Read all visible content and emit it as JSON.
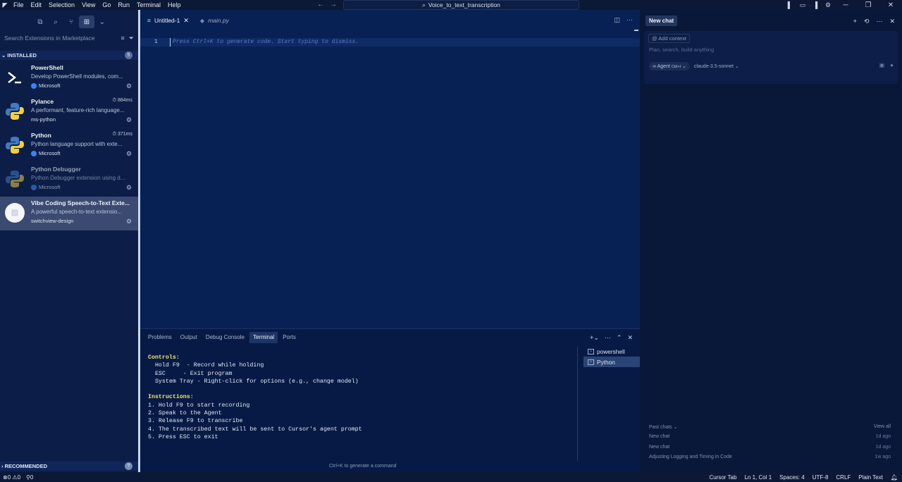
{
  "titlebar": {
    "menu": [
      "File",
      "Edit",
      "Selection",
      "View",
      "Go",
      "Run",
      "Terminal",
      "Help"
    ],
    "search_text": "Voice_to_text_transcription"
  },
  "sidebar": {
    "search_placeholder": "Search Extensions in Marketplace",
    "installed_label": "INSTALLED",
    "installed_count": "5",
    "recommended_label": "RECOMMENDED",
    "extensions": [
      {
        "name": "PowerShell",
        "description": "Develop PowerShell modules, com...",
        "publisher": "Microsoft",
        "time": ""
      },
      {
        "name": "Pylance",
        "description": "A performant, feature-rich language...",
        "publisher": "ms-python",
        "time": "884ms"
      },
      {
        "name": "Python",
        "description": "Python language support with exte...",
        "publisher": "Microsoft",
        "time": "371ms"
      },
      {
        "name": "Python Debugger",
        "description": "Python Debugger extension using d...",
        "publisher": "Microsoft",
        "time": ""
      },
      {
        "name": "Vibe Coding Speech-to-Text Exte...",
        "description": "A powerful speech-to-text extensio...",
        "publisher": "switchview-design",
        "time": ""
      }
    ]
  },
  "editor": {
    "tabs": [
      {
        "label": "Untitled-1",
        "active": true
      },
      {
        "label": "main.py",
        "active": false
      }
    ],
    "line_number": "1",
    "ghost_text": "Press Ctrl+K to generate code. Start typing to dismiss."
  },
  "panel": {
    "tabs": [
      "Problems",
      "Output",
      "Debug Console",
      "Terminal",
      "Ports"
    ],
    "active_tab": "Terminal",
    "terminal_lines": [
      {
        "text": "Controls:",
        "bold": true
      },
      {
        "text": "  Hold F9  - Record while holding",
        "bold": false
      },
      {
        "text": "  ESC     - Exit program",
        "bold": false
      },
      {
        "text": "  System Tray - Right-click for options (e.g., change model)",
        "bold": false
      },
      {
        "text": "",
        "bold": false
      },
      {
        "text": "Instructions:",
        "bold": true
      },
      {
        "text": "1. Hold F9 to start recording",
        "bold": false
      },
      {
        "text": "2. Speak to the Agent",
        "bold": false
      },
      {
        "text": "3. Release F9 to transcribe",
        "bold": false
      },
      {
        "text": "4. The transcribed text will be sent to Cursor's agent prompt",
        "bold": false
      },
      {
        "text": "5. Press ESC to exit",
        "bold": false
      }
    ],
    "terminals": [
      "powershell",
      "Python"
    ],
    "hint": "Ctrl+K to generate a command"
  },
  "chat": {
    "tab_label": "New chat",
    "add_context": "Add context",
    "placeholder": "Plan, search, build anything",
    "agent_label": "Agent",
    "agent_shortcut": "Ctrl+I",
    "model": "claude-3.5-sonnet",
    "past_label": "Past chats",
    "view_all": "View all",
    "past_chats": [
      {
        "title": "New chat",
        "ago": "1d ago"
      },
      {
        "title": "New chat",
        "ago": "1d ago"
      },
      {
        "title": "Adjusting Logging and Timing in Code",
        "ago": "1w ago"
      }
    ]
  },
  "statusbar": {
    "errors": "0",
    "warnings": "0",
    "ports": "0",
    "cursor_tab": "Cursor Tab",
    "position": "Ln 1, Col 1",
    "spaces": "Spaces: 4",
    "encoding": "UTF-8",
    "eol": "CRLF",
    "language": "Plain Text"
  }
}
